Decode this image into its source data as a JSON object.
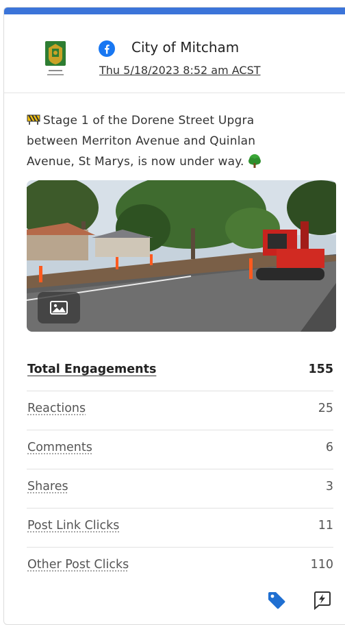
{
  "post": {
    "page_name": "City of Mitcham",
    "date": "Thu 5/18/2023 8:52 am ACST",
    "network_icon": "facebook-icon",
    "text_lines": [
      "Stage 1 of the Dorene Street Upgra",
      "between Merriton Avenue and Quinlan",
      "Avenue, St Marys, is now under way."
    ],
    "emojis": [
      "construction-barrier-icon",
      "tree-icon"
    ],
    "media_icon": "image-icon"
  },
  "metrics": [
    {
      "label": "Total Engagements",
      "value": "155"
    },
    {
      "label": "Reactions",
      "value": "25"
    },
    {
      "label": "Comments",
      "value": "6"
    },
    {
      "label": "Shares",
      "value": "3"
    },
    {
      "label": "Post Link Clicks",
      "value": "11"
    },
    {
      "label": "Other Post Clicks",
      "value": "110"
    }
  ],
  "footer_icons": [
    "tag-icon",
    "boost-icon"
  ],
  "colors": {
    "accent": "#3b74d9",
    "facebook": "#1877f2",
    "tag": "#1f6fd1"
  }
}
